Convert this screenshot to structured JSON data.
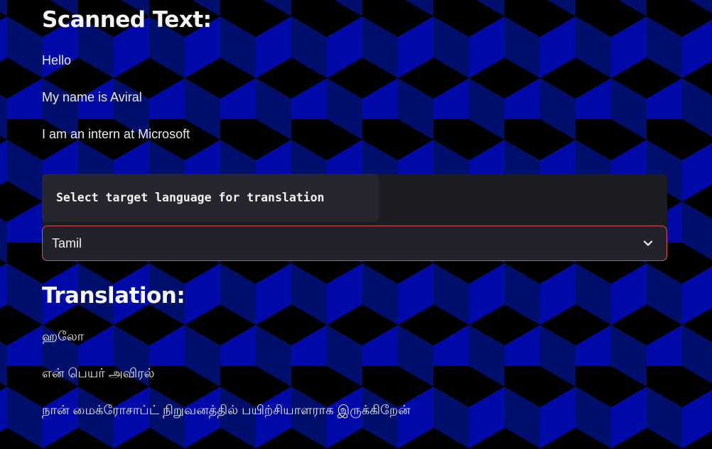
{
  "scanned": {
    "heading": "Scanned Text:",
    "lines": [
      "Hello",
      "My name is Aviral",
      "I am an intern at Microsoft"
    ]
  },
  "language_select": {
    "label": "Select target language for translation",
    "selected": "Tamil",
    "icon": "chevron-down-icon"
  },
  "translation": {
    "heading": "Translation:",
    "lines": [
      "ஹலோ",
      "என் பெயர் அவிரல்",
      "நான் மைக்ரோசாப்ட் நிறுவனத்தில் பயிற்சியாளராக இருக்கிறேன்"
    ]
  },
  "colors": {
    "pattern_dark": "#000000",
    "pattern_mid": "#000f6c",
    "pattern_bright": "#000aa8",
    "select_border": "#d9505a"
  }
}
